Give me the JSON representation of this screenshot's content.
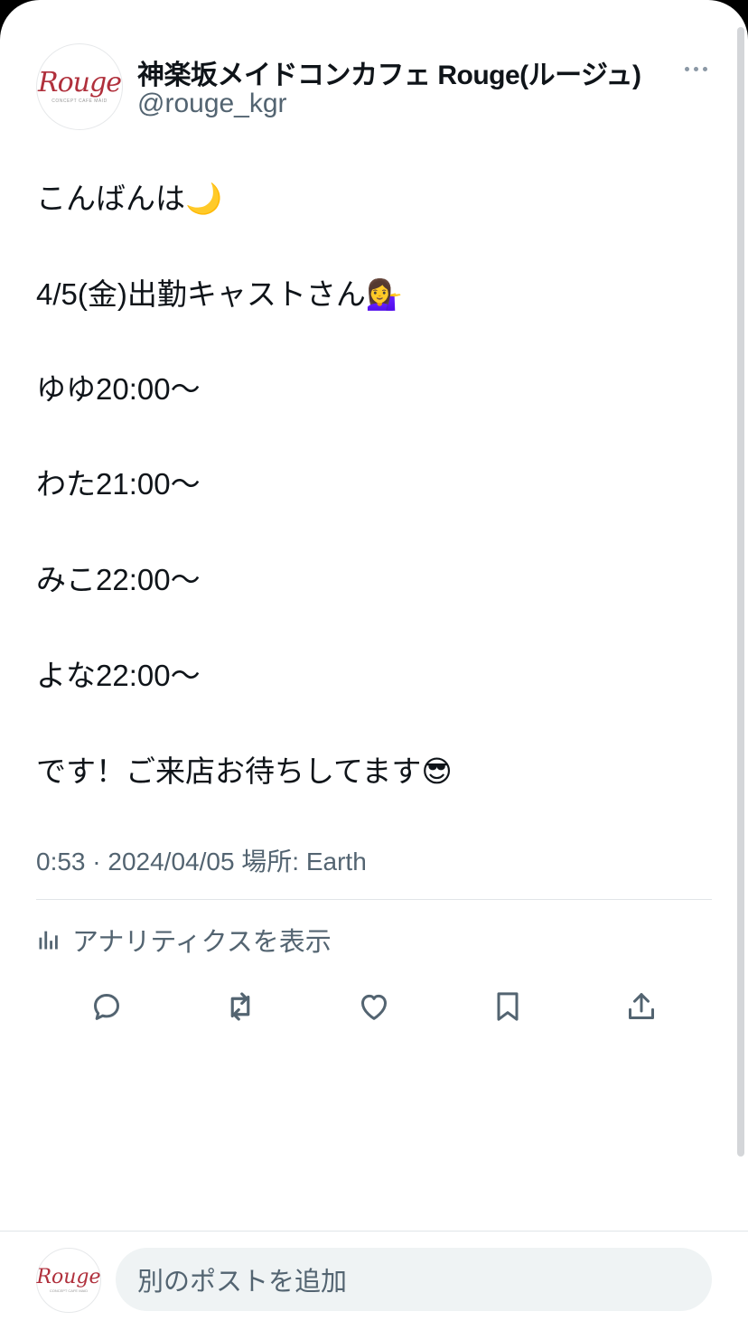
{
  "post": {
    "author": {
      "display_name": "神楽坂メイドコンカフェ Rouge(ルージュ)",
      "handle": "@rouge_kgr",
      "avatar_logo": "Rouge",
      "avatar_subtext": "CONCEPT CAFE MAID"
    },
    "lines": [
      "こんばんは🌙",
      "4/5(金)出勤キャストさん💁‍♀️",
      "ゆゆ20:00〜",
      "わた21:00〜",
      "みこ22:00〜",
      "よな22:00〜",
      "です！ご来店お待ちしてます😎"
    ],
    "meta": "0:53 · 2024/04/05 場所: Earth",
    "analytics_label": "アナリティクスを表示"
  },
  "actions": {
    "icons": [
      "reply-icon",
      "repost-icon",
      "like-icon",
      "bookmark-icon",
      "share-icon"
    ]
  },
  "composer": {
    "placeholder": "別のポストを追加",
    "avatar_logo": "Rouge",
    "avatar_subtext": "CONCEPT CAFE MAID"
  },
  "colors": {
    "text": "#0f1419",
    "secondary": "#536471",
    "brand": "#b0303c",
    "input_bg": "#eff3f4"
  }
}
